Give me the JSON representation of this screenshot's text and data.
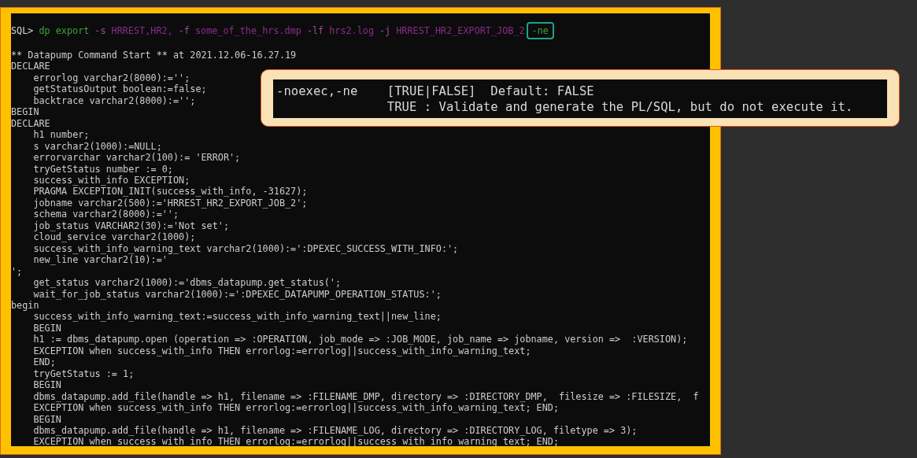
{
  "command": [
    {
      "text": "SQL>",
      "color": "#d6d6d6",
      "highlighted": false
    },
    {
      "text": "dp export",
      "color": "#3aa33a",
      "highlighted": false
    },
    {
      "text": "-s",
      "color": "#a04aa0",
      "highlighted": false
    },
    {
      "text": "HRREST,HR2,",
      "color": "#8a2c8a",
      "highlighted": false
    },
    {
      "text": "-f",
      "color": "#a04aa0",
      "highlighted": false
    },
    {
      "text": "some_of_the_hrs.dmp",
      "color": "#8a2c8a",
      "highlighted": false
    },
    {
      "text": "-lf",
      "color": "#a04aa0",
      "highlighted": false
    },
    {
      "text": "hrs2.log",
      "color": "#8a2c8a",
      "highlighted": false
    },
    {
      "text": "-j",
      "color": "#a04aa0",
      "highlighted": false
    },
    {
      "text": "HRREST_HR2_EXPORT_JOB_2",
      "color": "#8a2c8a",
      "highlighted": false
    },
    {
      "text": "-ne",
      "color": "#3aa33a",
      "highlighted": true
    }
  ],
  "output_lines": [
    "** Datapump Command Start ** at 2021.12.06-16.27.19",
    "DECLARE",
    "    errorlog varchar2(8000):='';",
    "    getStatusOutput boolean:=false;",
    "    backtrace varchar2(8000):='';",
    "BEGIN",
    "DECLARE",
    "    h1 number;",
    "    s varchar2(1000):=NULL;",
    "    errorvarchar varchar2(100):= 'ERROR';",
    "    tryGetStatus number := 0;",
    "    success_with_info EXCEPTION;",
    "    PRAGMA EXCEPTION_INIT(success_with_info, -31627);",
    "    jobname varchar2(500):='HRREST_HR2_EXPORT_JOB_2';",
    "    schema varchar2(8000):='';",
    "    job_status VARCHAR2(30):='Not set';",
    "    cloud_service varchar2(1000);",
    "    success_with_info_warning_text varchar2(1000):=':DPEXEC_SUCCESS_WITH_INFO:';",
    "    new_line varchar2(10):='",
    "';",
    "    get_status varchar2(1000):='dbms_datapump.get_status(';",
    "    wait_for_job_status varchar2(1000):=':DPEXEC_DATAPUMP_OPERATION_STATUS:';",
    "begin",
    "    success_with_info_warning_text:=success_with_info_warning_text||new_line;",
    "    BEGIN",
    "    h1 := dbms_datapump.open (operation => :OPERATION, job_mode => :JOB_MODE, job_name => jobname, version =>  :VERSION);",
    "    EXCEPTION when success_with_info THEN errorlog:=errorlog||success_with_info_warning_text;",
    "    END;",
    "    tryGetStatus := 1;",
    "    BEGIN",
    "    dbms_datapump.add_file(handle => h1, filename => :FILENAME_DMP, directory => :DIRECTORY_DMP,  filesize => :FILESIZE,  f",
    "    EXCEPTION when success_with_info THEN errorlog:=errorlog||success_with_info_warning_text; END;",
    "    BEGIN",
    "    dbms_datapump.add_file(handle => h1, filename => :FILENAME_LOG, directory => :DIRECTORY_LOG, filetype => 3);",
    "    EXCEPTION when success_with_info THEN errorlog:=errorlog||success_with_info_warning_text; END;"
  ],
  "callout": {
    "lines": [
      "-noexec,-ne    [TRUE|FALSE]  Default: FALSE",
      "               TRUE : Validate and generate the PL/SQL, but do not execute it."
    ]
  }
}
